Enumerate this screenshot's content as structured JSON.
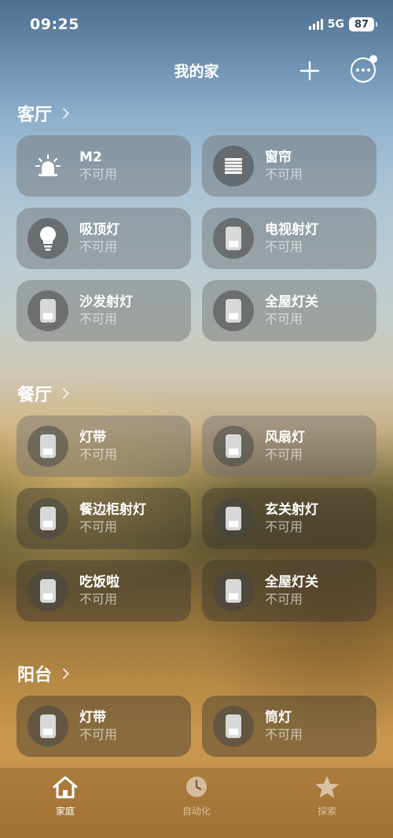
{
  "status_bar": {
    "time": "09:25",
    "network": "5G",
    "battery": "87"
  },
  "nav": {
    "title": "我的家",
    "add_icon": "plus-icon",
    "more_icon": "ellipsis-circle-icon"
  },
  "sections": [
    {
      "title": "客厅",
      "tiles": [
        {
          "name": "M2",
          "status": "不可用",
          "icon": "alarm-siren-icon"
        },
        {
          "name": "窗帘",
          "status": "不可用",
          "icon": "blinds-icon"
        },
        {
          "name": "吸顶灯",
          "status": "不可用",
          "icon": "lightbulb-icon"
        },
        {
          "name": "电视射灯",
          "status": "不可用",
          "icon": "switch-icon"
        },
        {
          "name": "沙发射灯",
          "status": "不可用",
          "icon": "switch-icon"
        },
        {
          "name": "全屋灯关",
          "status": "不可用",
          "icon": "switch-icon"
        }
      ]
    },
    {
      "title": "餐厅",
      "tiles": [
        {
          "name": "灯带",
          "status": "不可用",
          "icon": "switch-icon"
        },
        {
          "name": "风扇灯",
          "status": "不可用",
          "icon": "switch-icon"
        },
        {
          "name": "餐边柜射灯",
          "status": "不可用",
          "icon": "switch-icon"
        },
        {
          "name": "玄关射灯",
          "status": "不可用",
          "icon": "switch-icon"
        },
        {
          "name": "吃饭啦",
          "status": "不可用",
          "icon": "switch-icon"
        },
        {
          "name": "全屋灯关",
          "status": "不可用",
          "icon": "switch-icon"
        }
      ]
    },
    {
      "title": "阳台",
      "tiles": [
        {
          "name": "灯带",
          "status": "不可用",
          "icon": "switch-icon"
        },
        {
          "name": "筒灯",
          "status": "不可用",
          "icon": "switch-icon"
        }
      ]
    }
  ],
  "tab_bar": [
    {
      "label": "家庭",
      "icon": "house-icon",
      "active": true
    },
    {
      "label": "自动化",
      "icon": "clock-icon",
      "active": false
    },
    {
      "label": "探索",
      "icon": "star-icon",
      "active": false
    }
  ]
}
